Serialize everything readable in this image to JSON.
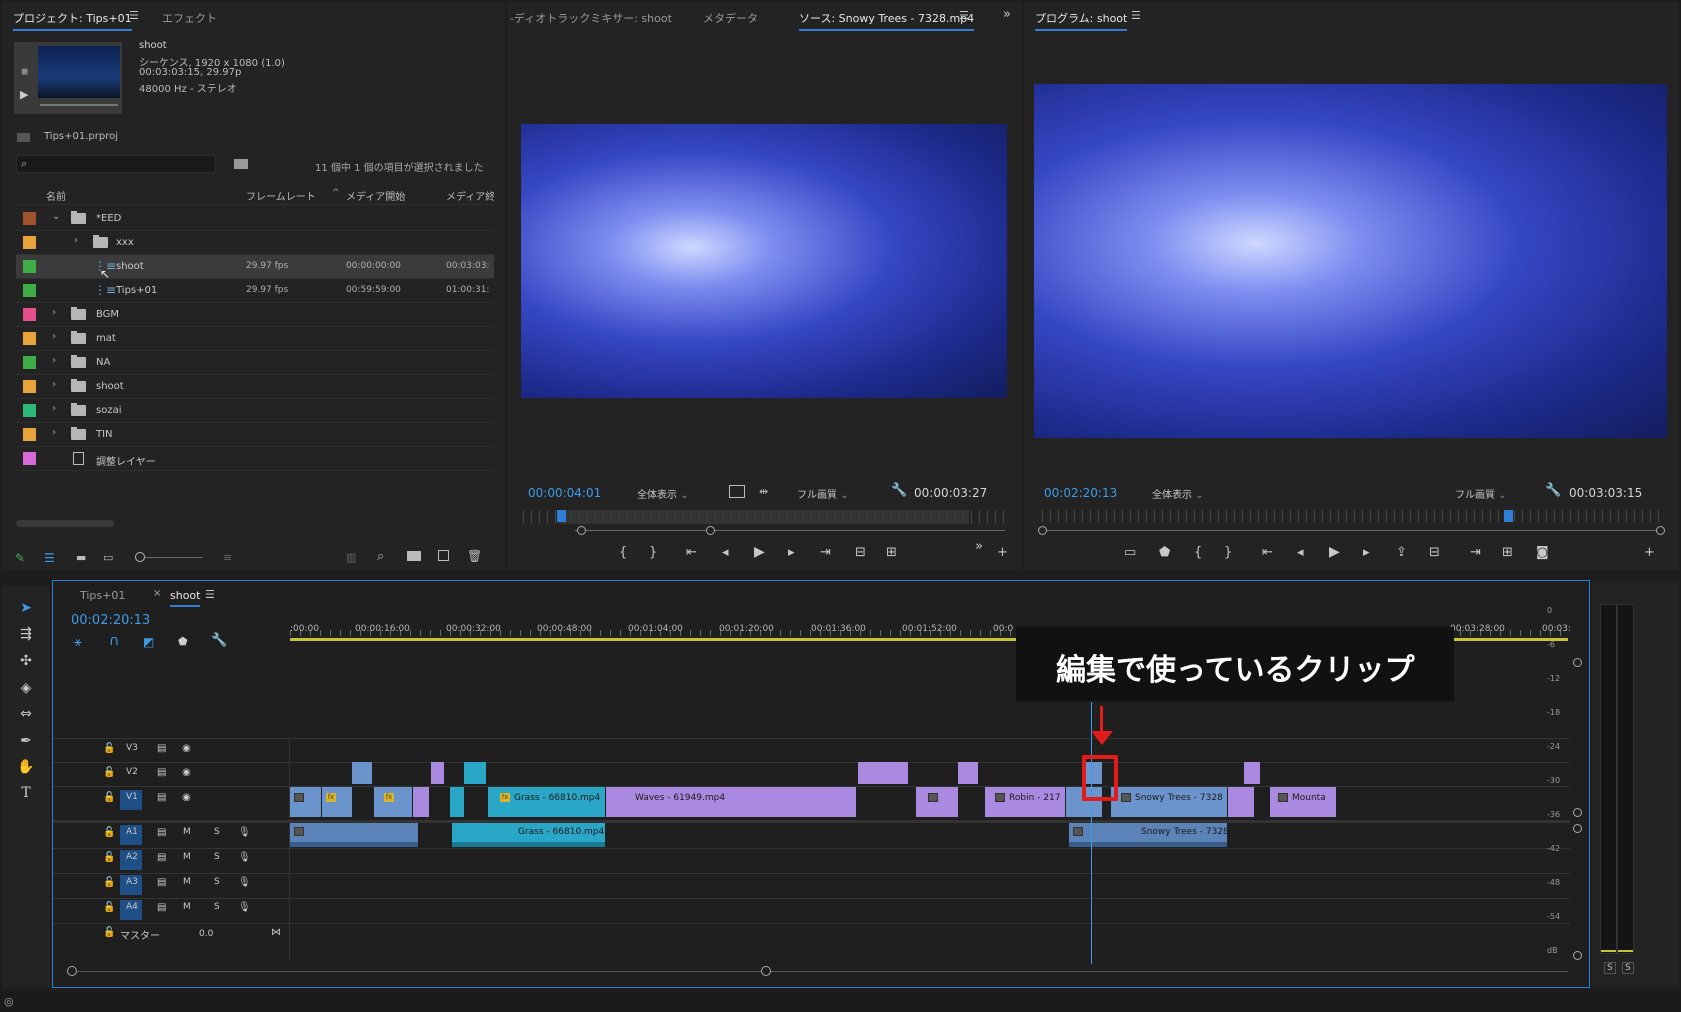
{
  "project_panel": {
    "tabs": [
      "プロジェクト: Tips+01",
      "エフェクト"
    ],
    "preview": {
      "name": "shoot",
      "line1": "シーケンス, 1920 x 1080 (1.0)",
      "line2": "00:03:03:15, 29.97p",
      "line3": "48000 Hz - ステレオ"
    },
    "project_file": "Tips+01.prproj",
    "search_placeholder": "",
    "selection_status": "11 個中 1 個の項目が選択されました",
    "columns": [
      "名前",
      "フレームレート",
      "メディア開始",
      "メディア終"
    ],
    "items": [
      {
        "name": "*EED",
        "type": "folder",
        "color": "#a0522d",
        "expanded": true,
        "depth": 0
      },
      {
        "name": "xxx",
        "type": "folder",
        "color": "#e8a33a",
        "depth": 1
      },
      {
        "name": "shoot",
        "type": "sequence",
        "color": "#3fae49",
        "fps": "29.97 fps",
        "start": "00:00:00:00",
        "end": "00:03:03:",
        "depth": 1,
        "selected": true
      },
      {
        "name": "Tips+01",
        "type": "sequence",
        "color": "#3fae49",
        "fps": "29.97 fps",
        "start": "00:59:59:00",
        "end": "01:00:31:",
        "depth": 1
      },
      {
        "name": "BGM",
        "type": "folder",
        "color": "#e5508c",
        "depth": 0
      },
      {
        "name": "mat",
        "type": "folder",
        "color": "#e8a33a",
        "depth": 0
      },
      {
        "name": "NA",
        "type": "folder",
        "color": "#3fae49",
        "depth": 0
      },
      {
        "name": "shoot",
        "type": "folder",
        "color": "#e8a33a",
        "depth": 0
      },
      {
        "name": "sozai",
        "type": "folder",
        "color": "#2db87a",
        "depth": 0
      },
      {
        "name": "TIN",
        "type": "folder",
        "color": "#e8a33a",
        "depth": 0
      },
      {
        "name": "調整レイヤー",
        "type": "adjustment",
        "color": "#d86ad8",
        "depth": 0
      }
    ]
  },
  "source_panel": {
    "tabs": [
      "-ディオトラックミキサー: shoot",
      "メタデータ",
      "ソース: Snowy Trees - 7328.mp4"
    ],
    "timecode": "00:00:04:01",
    "fit": "全体表示",
    "quality": "フル画質",
    "duration": "00:00:03:27"
  },
  "program_panel": {
    "tab": "プログラム: shoot",
    "timecode": "00:02:20:13",
    "fit": "全体表示",
    "quality": "フル画質",
    "duration": "00:03:03:15"
  },
  "timeline": {
    "tabs": [
      "Tips+01",
      "shoot"
    ],
    "timecode": "00:02:20:13",
    "ruler": [
      ":00:00",
      "00:00:16:00",
      "00:00:32:00",
      "00:00:48:00",
      "00:01:04:00",
      "00:01:20:00",
      "00:01:36:00",
      "00:01:52:00",
      "00:0",
      "00:03:28:00",
      "00:03:"
    ],
    "tracks_video": [
      "V3",
      "V2",
      "V1"
    ],
    "tracks_audio": [
      "A1",
      "A2",
      "A3",
      "A4"
    ],
    "track_letters": {
      "m": "M",
      "s": "S"
    },
    "master_label": "マスター",
    "master_value": "0.0",
    "clips": {
      "grass_v": "Grass - 66810.mp4",
      "waves_v": "Waves - 61949.mp4",
      "robin_v": "Robin - 217",
      "snowy_v": "Snowy Trees - 7328",
      "mounta_v": "Mounta",
      "grass_a": "Grass - 66810.mp4",
      "snowy_a": "Snowy Trees - 7328"
    },
    "annotation": "編集で使っているクリップ",
    "fx_label": "fx"
  },
  "meter": {
    "labels": [
      "0",
      "-6",
      "-12",
      "-18",
      "-24",
      "-30",
      "-36",
      "-42",
      "-48",
      "-54",
      "dB"
    ],
    "solo": [
      "S",
      "S"
    ]
  },
  "colors": {
    "accent": "#2f7fd8",
    "clip_blue": "#6b94cc",
    "clip_purple": "#a98ae0",
    "clip_teal": "#2aa7c6",
    "highlight": "#e21b1b"
  }
}
